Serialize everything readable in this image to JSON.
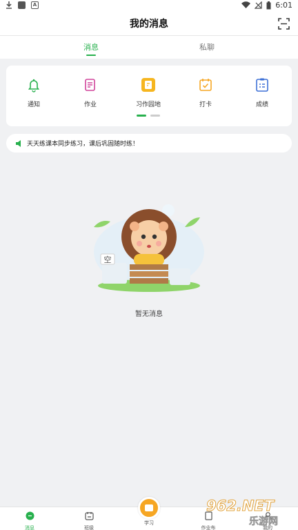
{
  "status_bar": {
    "time": "6:01"
  },
  "header": {
    "title": "我的消息"
  },
  "tabs": [
    {
      "label": "消息",
      "active": true
    },
    {
      "label": "私聊",
      "active": false
    }
  ],
  "entries": [
    {
      "label": "通知",
      "icon": "bell-icon"
    },
    {
      "label": "作业",
      "icon": "homework-icon"
    },
    {
      "label": "习作园地",
      "icon": "composition-icon"
    },
    {
      "label": "打卡",
      "icon": "checkin-icon"
    },
    {
      "label": "成绩",
      "icon": "score-icon"
    }
  ],
  "carousel": {
    "pages": 2,
    "current": 1
  },
  "notice": {
    "text": "天天练课本同步练习，课后巩固随时练！"
  },
  "empty": {
    "badge": "空",
    "text": "暂无消息"
  },
  "bottom_nav": [
    {
      "label": "消息",
      "active": true,
      "icon": "chat-icon"
    },
    {
      "label": "班级",
      "active": false,
      "icon": "class-icon"
    },
    {
      "label": "学习",
      "active": false,
      "icon": "study-icon"
    },
    {
      "label": "作业布",
      "active": false,
      "icon": "assign-icon"
    },
    {
      "label": "我的",
      "active": false,
      "icon": "me-icon"
    }
  ],
  "watermark": {
    "line1": "962.NET",
    "line2": "乐游网"
  },
  "colors": {
    "accent": "#27b04d",
    "orange": "#f6a623",
    "purple": "#d0449a",
    "blue": "#3b6fd6"
  }
}
